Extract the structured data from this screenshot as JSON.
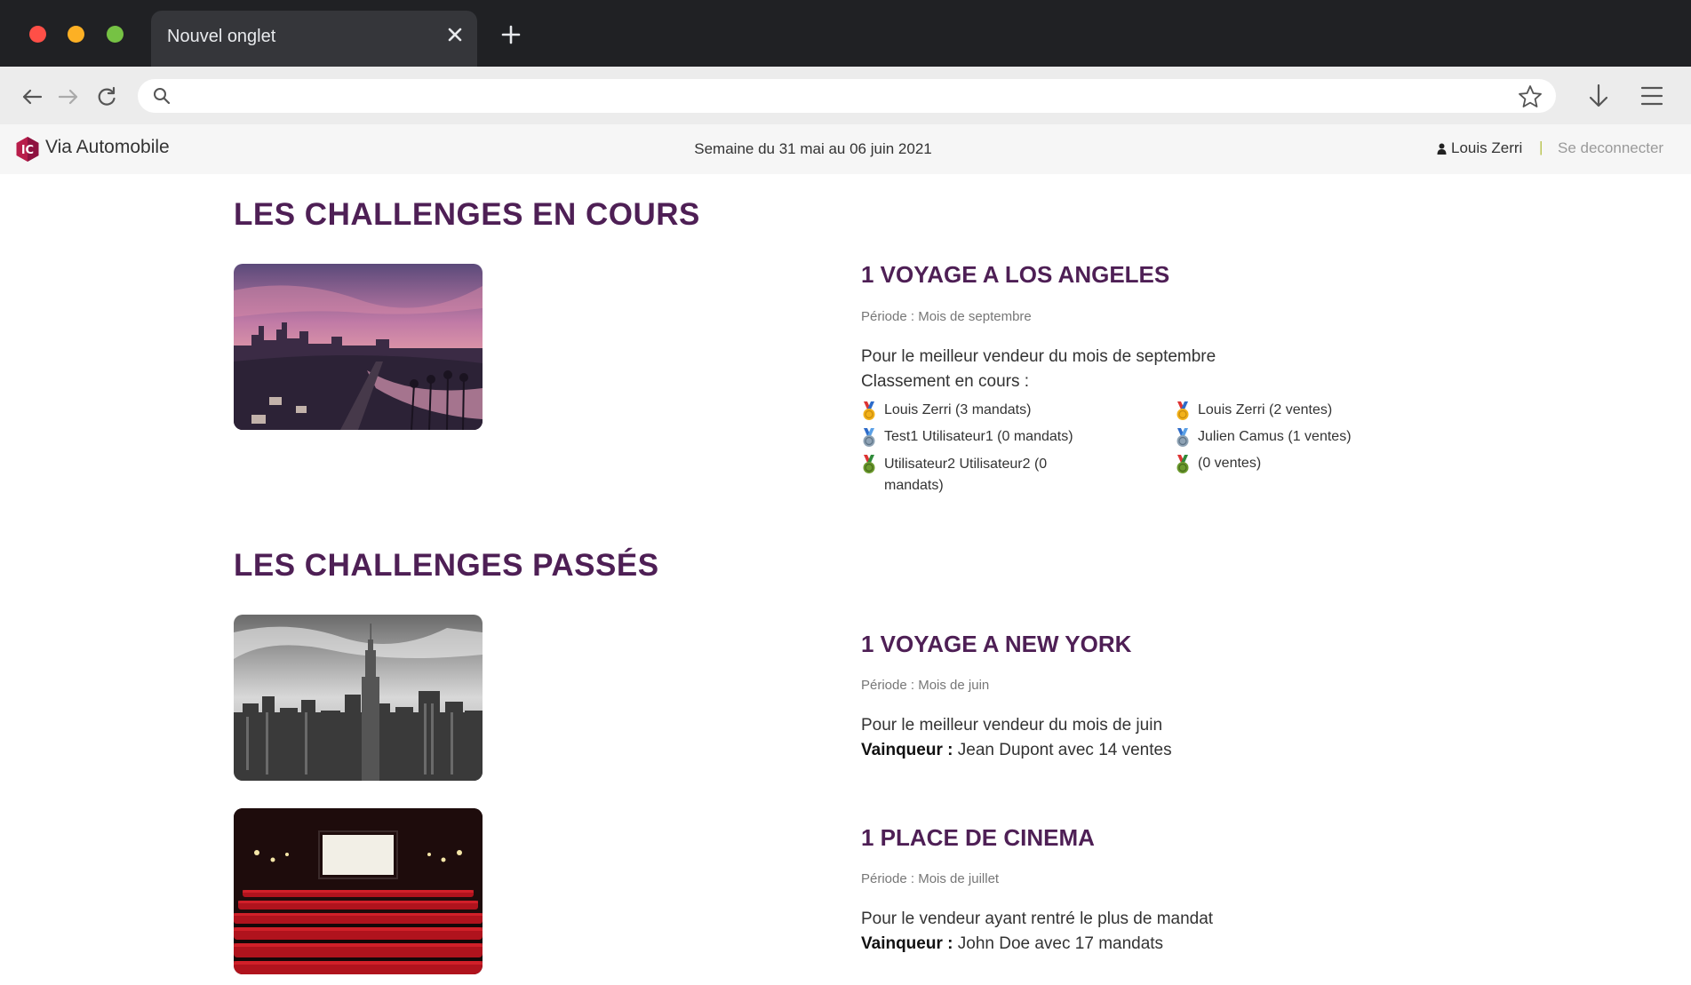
{
  "browser": {
    "tab_title": "Nouvel onglet",
    "address_value": "",
    "address_placeholder": ""
  },
  "header": {
    "brand": "Via Automobile",
    "week": "Semaine du 31 mai au 06 juin 2021",
    "user_name": "Louis Zerri",
    "separator": "|",
    "logout": "Se deconnecter"
  },
  "current": {
    "section_title": "LES CHALLENGES EN COURS",
    "challenge": {
      "title": "1 VOYAGE A LOS ANGELES",
      "period": "Période : Mois de septembre",
      "description": "Pour le meilleur vendeur du mois de septembre",
      "ranking_label": "Classement en cours :",
      "ranking_mandats": [
        {
          "medal": "gold",
          "text": "Louis Zerri (3 mandats)"
        },
        {
          "medal": "silver",
          "text": "Test1 Utilisateur1 (0 mandats)"
        },
        {
          "medal": "bronze",
          "text": "Utilisateur2 Utilisateur2 (0 mandats)"
        }
      ],
      "ranking_ventes": [
        {
          "medal": "gold",
          "text": "Louis Zerri (2 ventes)"
        },
        {
          "medal": "silver",
          "text": "Julien Camus (1 ventes)"
        },
        {
          "medal": "bronze",
          "text": "(0 ventes)"
        }
      ]
    }
  },
  "past": {
    "section_title": "LES CHALLENGES PASSÉS",
    "winner_label": "Vainqueur :",
    "challenges": [
      {
        "title": "1 VOYAGE A NEW YORK",
        "period": "Période : Mois de juin",
        "description": "Pour le meilleur vendeur du mois de juin",
        "winner": "Jean Dupont avec 14 ventes"
      },
      {
        "title": "1 PLACE DE CINEMA",
        "period": "Période : Mois de juillet",
        "description": "Pour le vendeur ayant rentré le plus de mandat",
        "winner": "John Doe avec 17 mandats"
      }
    ]
  },
  "colors": {
    "heading": "#4e1f55",
    "chrome_dark": "#202124",
    "toolbar": "#ececec",
    "medal_gold": "#f2b21b",
    "medal_silver": "#8fa3b5",
    "medal_bronze": "#6c9a2e"
  }
}
